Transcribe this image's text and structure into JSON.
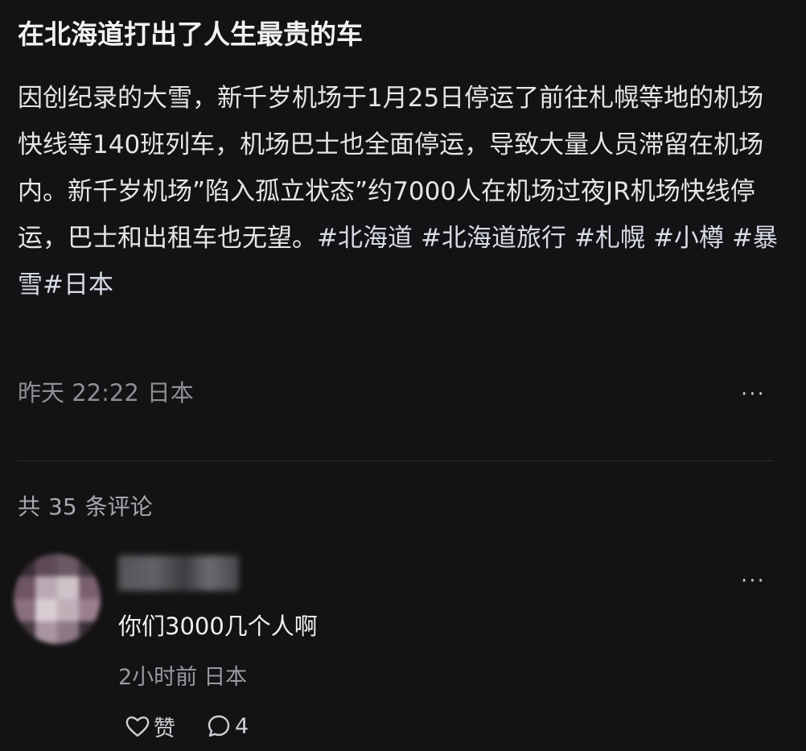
{
  "post": {
    "title": "在北海道打出了人生最贵的车",
    "body": "因创纪录的大雪，新千岁机场于1月25日停运了前往札幌等地的机场快线等140班列车，机场巴士也全面停运，导致大量人员滞留在机场内。新千岁机场”陷入孤立状态”约7000人在机场过夜JR机场快线停运，巴士和出租车也无望。",
    "hashtags": [
      "#北海道",
      "#北海道旅行",
      "#札幌",
      "#小樽",
      "#暴雪#日本"
    ],
    "time": "昨天 22:22",
    "location": "日本",
    "more_icon": "more-horizontal-icon",
    "more_label": "···"
  },
  "comments_header": {
    "prefix": "共",
    "count": "35",
    "suffix": "条评论"
  },
  "comment": {
    "text": "你们3000几个人啊",
    "time": "2小时前",
    "location": "日本",
    "more_label": "···",
    "like_icon": "heart-icon",
    "like_label": "赞",
    "reply_icon": "comment-bubble-icon",
    "reply_count": "4"
  },
  "colors": {
    "background": "#131214",
    "text": "#ecebed",
    "muted": "#8f8e93",
    "divider": "#2c2b2f"
  }
}
